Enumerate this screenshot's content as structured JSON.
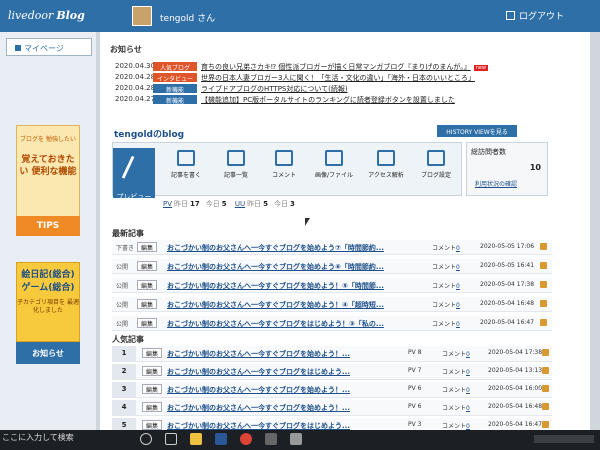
{
  "header": {
    "logo_text": "livedoor",
    "logo_blog": "Blog",
    "username": "tengold さん",
    "logout": "ログアウト"
  },
  "sidebar": {
    "mypage": "マイページ",
    "promo1_small": "ブログを 勉強したい",
    "promo1_big": "覚えておきたい 便利な機能",
    "tips": "TIPS",
    "promo2_big": "絵日記(総合) ゲーム(総合)",
    "promo2_small": "子カテゴリ項目を 最適化しました",
    "news": "お知らせ"
  },
  "news": {
    "title": "お知らせ",
    "items": [
      {
        "date": "2020.04.30",
        "tag": "人気ブログ",
        "tag_color": "#e0542a",
        "text": "育ちの良い兄弟さカキ⁉ 個性派ブロガーが描く日常マンガブログ『まりげのまんが。』",
        "new": "new"
      },
      {
        "date": "2020.04.28",
        "tag": "インタビュー",
        "tag_color": "#e0542a",
        "text": "世界の日本人妻ブロガー3人に聞く！「生活・文化の違い」「海外・日本のいいところ」",
        "new": ""
      },
      {
        "date": "2020.04.28",
        "tag": "新機能",
        "tag_color": "#2f6fa8",
        "text": "ライブドアブログのHTTPS対応について(続報)",
        "new": ""
      },
      {
        "date": "2020.04.27",
        "tag": "新機能",
        "tag_color": "#2f6fa8",
        "text": "【機能追加】PC版ポータルサイトのランキングに読者登録ボタンを設置しました",
        "new": ""
      }
    ]
  },
  "blog": {
    "name": "tengoldのblog",
    "history_btn": "HISTORY VIEWを見る",
    "preview": "プレビュー",
    "tools": [
      {
        "label": "記事を書く",
        "icon": "pencil-icon"
      },
      {
        "label": "記事一覧",
        "icon": "document-icon"
      },
      {
        "label": "コメント",
        "icon": "speech-bubble-icon"
      },
      {
        "label": "画像/ファイル",
        "icon": "image-icon"
      },
      {
        "label": "アクセス解析",
        "icon": "bar-chart-icon"
      },
      {
        "label": "ブログ設定",
        "icon": "wrench-icon"
      }
    ],
    "visitors_title": "総訪問者数",
    "visitors_count": "10",
    "visitors_link": "利用状況の確認",
    "stats": {
      "pv": "PV",
      "uu": "UU",
      "yesterday": "昨日",
      "today": "今日",
      "pv_yesterday": "17",
      "pv_today": "5",
      "uu_yesterday": "5",
      "uu_today": "3"
    }
  },
  "latest": {
    "title": "最新記事",
    "edit": "編集",
    "comment_label": "コメント",
    "rows": [
      {
        "status": "下書き",
        "title": "おこづかい制のお父さんへ一今すぐブログを始めよう⑦「時間節約...",
        "comments": "0",
        "date": "2020-05-05 17:06"
      },
      {
        "status": "公開",
        "title": "おこづかい制のお父さんへ一今すぐブログを始めよう⑥「時間節約...",
        "comments": "0",
        "date": "2020-05-05 16:41"
      },
      {
        "status": "公開",
        "title": "おこづかい制のお父さんへ一今すぐブログを始めよう！⑤「時間節...",
        "comments": "0",
        "date": "2020-05-04 17:38"
      },
      {
        "status": "公開",
        "title": "おこづかい制のお父さんへ一今すぐブログを始めよう！④「超時短...",
        "comments": "0",
        "date": "2020-05-04 16:48"
      },
      {
        "status": "公開",
        "title": "おこづかい制のお父さんへ一今すぐブログをはじめよう！③「私の...",
        "comments": "0",
        "date": "2020-05-04 16:47"
      }
    ]
  },
  "popular": {
    "title": "人気記事",
    "rows": [
      {
        "rank": "1",
        "title": "おこづかい制のお父さんへ一今すぐブログを始めよう！...",
        "pv": "PV 8",
        "comments": "0",
        "date": "2020-05-04 17:38"
      },
      {
        "rank": "2",
        "title": "おこづかい制のお父さんへ一今すぐブログをはじめよう...",
        "pv": "PV 7",
        "comments": "0",
        "date": "2020-05-04 13:13"
      },
      {
        "rank": "3",
        "title": "おこづかい制のお父さんへ一今すぐブログを始めよう！...",
        "pv": "PV 6",
        "comments": "0",
        "date": "2020-05-04 16:00"
      },
      {
        "rank": "4",
        "title": "おこづかい制のお父さんへ一今すぐブログを始めよう！...",
        "pv": "PV 6",
        "comments": "0",
        "date": "2020-05-04 16:48"
      },
      {
        "rank": "5",
        "title": "おこづかい制のお父さんへ一今すぐブログをはじめよう...",
        "pv": "PV 3",
        "comments": "0",
        "date": "2020-05-04 16:47"
      }
    ]
  },
  "taskbar": {
    "search": "ここに入力して検索"
  }
}
